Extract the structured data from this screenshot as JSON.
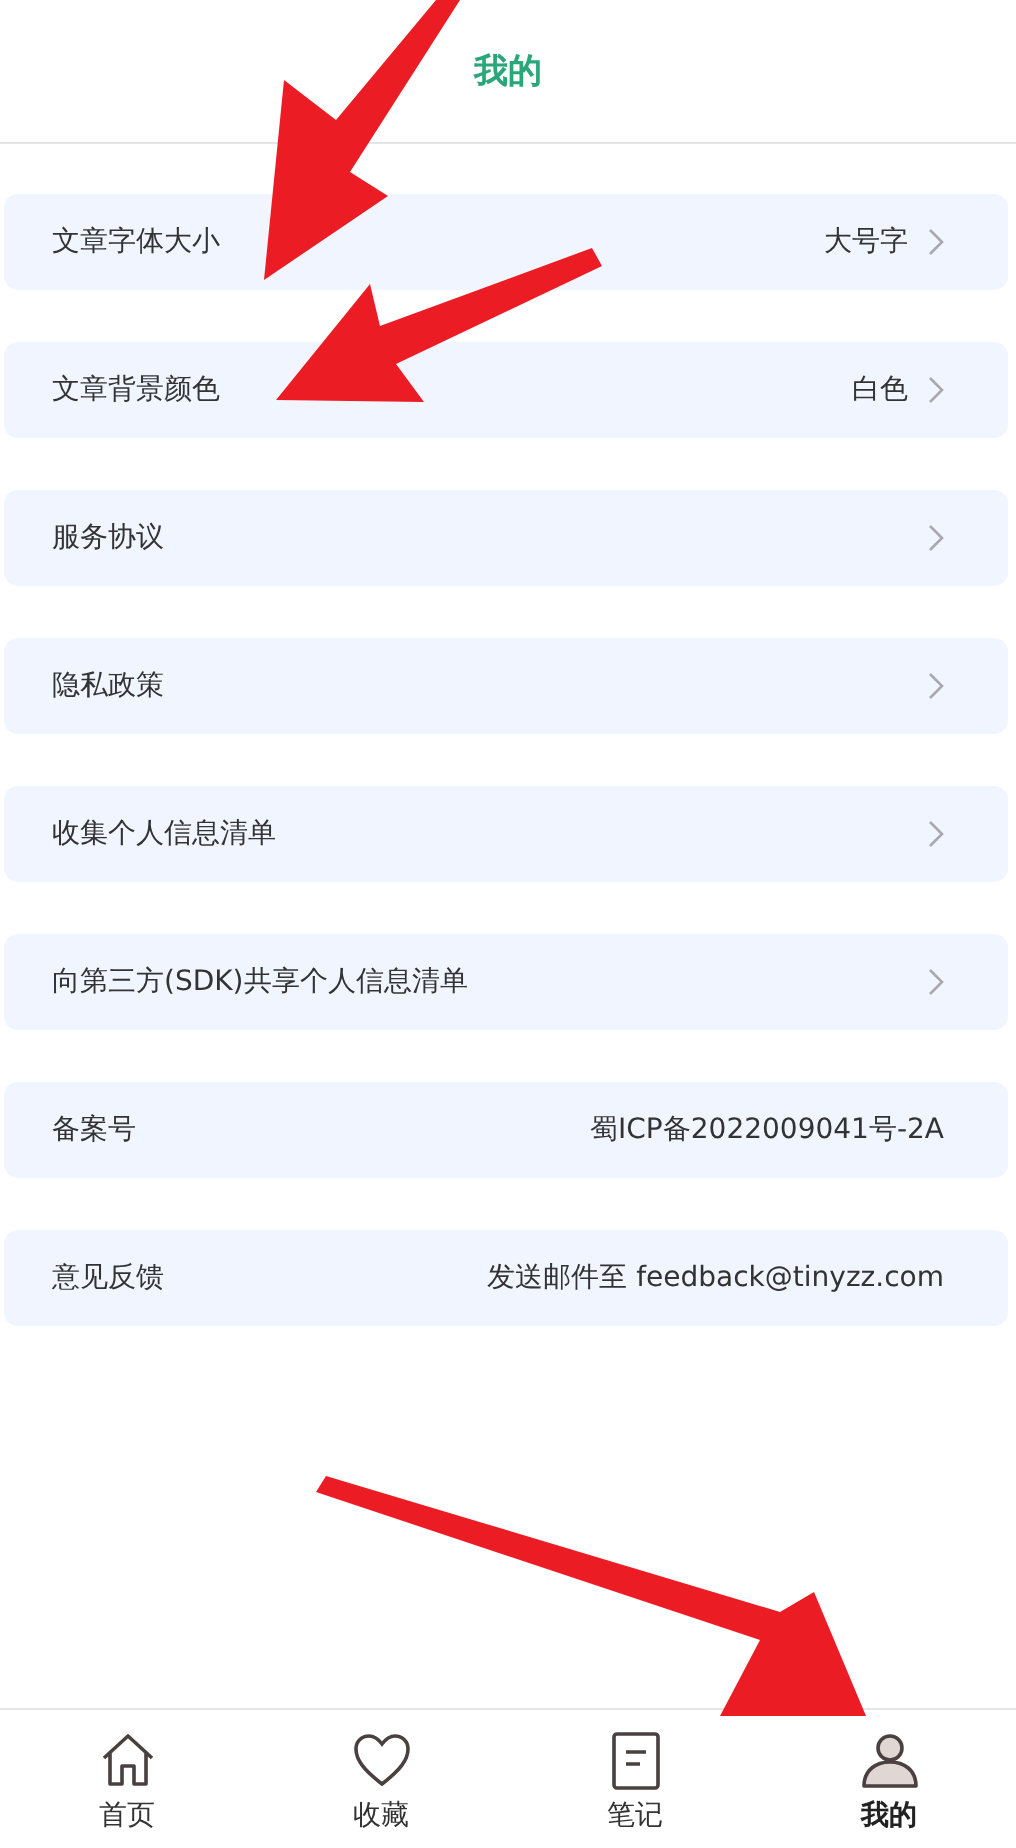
{
  "header": {
    "title": "我的"
  },
  "settings": [
    {
      "label": "文章字体大小",
      "value": "大号字",
      "chevron": true
    },
    {
      "label": "文章背景颜色",
      "value": "白色",
      "chevron": true
    },
    {
      "label": "服务协议",
      "chevron": true
    },
    {
      "label": "隐私政策",
      "chevron": true
    },
    {
      "label": "收集个人信息清单",
      "chevron": true
    },
    {
      "label": "向第三方(SDK)共享个人信息清单",
      "chevron": true
    },
    {
      "label": "备案号",
      "value": "蜀ICP备2022009041号-2A",
      "chevron": false
    },
    {
      "label": "意见反馈",
      "value": "发送邮件至 feedback@tinyzz.com",
      "chevron": false
    }
  ],
  "tab_bar": [
    {
      "label": "首页",
      "kind": "home",
      "selected": false
    },
    {
      "label": "收藏",
      "kind": "heart",
      "selected": false
    },
    {
      "label": "笔记",
      "kind": "note",
      "selected": false
    },
    {
      "label": "我的",
      "kind": "person",
      "selected": true
    }
  ],
  "annotations": [
    {
      "kind": "arrow"
    },
    {
      "kind": "arrow"
    },
    {
      "kind": "arrow"
    }
  ]
}
